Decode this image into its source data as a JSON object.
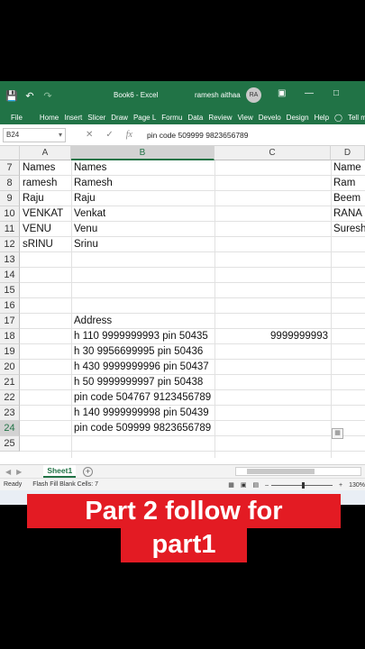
{
  "titlebar": {
    "title": "Book6 - Excel",
    "user": "ramesh aithaa",
    "avatar": "RA",
    "save_icon": "save-icon",
    "undo_icon": "undo-icon",
    "redo_icon": "redo-icon"
  },
  "ribbon": {
    "tabs": [
      "File",
      "Home",
      "Insert",
      "Slicer",
      "Draw",
      "Page L",
      "Formu",
      "Data",
      "Review",
      "View",
      "Develo",
      "Design",
      "Help",
      "Tell me"
    ]
  },
  "formula_bar": {
    "name_box": "B24",
    "fx": "fx",
    "formula": "pin code 509999 9823656789"
  },
  "columns": [
    "A",
    "B",
    "C",
    "D"
  ],
  "rows": [
    {
      "num": "7",
      "A": "Names",
      "B": "Names",
      "C": "",
      "D": "Name"
    },
    {
      "num": "8",
      "A": "ramesh",
      "B": "Ramesh",
      "C": "",
      "D": "Ram"
    },
    {
      "num": "9",
      "A": "Raju",
      "B": "Raju",
      "C": "",
      "D": "Beem"
    },
    {
      "num": "10",
      "A": "VENKAT",
      "B": "Venkat",
      "C": "",
      "D": "RANA"
    },
    {
      "num": "11",
      "A": "VENU",
      "B": "Venu",
      "C": "",
      "D": "Suresh"
    },
    {
      "num": "12",
      "A": "sRINU",
      "B": "Srinu",
      "C": "",
      "D": ""
    },
    {
      "num": "13",
      "A": "",
      "B": "",
      "C": "",
      "D": ""
    },
    {
      "num": "14",
      "A": "",
      "B": "",
      "C": "",
      "D": ""
    },
    {
      "num": "15",
      "A": "",
      "B": "",
      "C": "",
      "D": ""
    },
    {
      "num": "16",
      "A": "",
      "B": "",
      "C": "",
      "D": ""
    },
    {
      "num": "17",
      "A": "",
      "B": "Address",
      "C": "",
      "D": ""
    },
    {
      "num": "18",
      "A": "",
      "B": "h 110 9999999993 pin 50435",
      "C": "9999999993",
      "D": ""
    },
    {
      "num": "19",
      "A": "",
      "B": "h 30 9956699995 pin 50436",
      "C": "",
      "D": ""
    },
    {
      "num": "20",
      "A": "",
      "B": "h 430 9999999996 pin 50437",
      "C": "",
      "D": ""
    },
    {
      "num": "21",
      "A": "",
      "B": "h 50 9999999997 pin 50438",
      "C": "",
      "D": ""
    },
    {
      "num": "22",
      "A": "",
      "B": "pin code 504767 9123456789",
      "C": "",
      "D": ""
    },
    {
      "num": "23",
      "A": "",
      "B": "h 140 9999999998 pin 50439",
      "C": "",
      "D": ""
    },
    {
      "num": "24",
      "A": "",
      "B": "pin code 509999 9823656789",
      "C": "",
      "D": ""
    },
    {
      "num": "25",
      "A": "",
      "B": "",
      "C": "",
      "D": ""
    }
  ],
  "sheet_tab": "Sheet1",
  "status": {
    "ready": "Ready",
    "flash_fill": "Flash Fill Blank Cells: 7",
    "zoom": "130%"
  },
  "banner": {
    "line1": "Part 2 follow for",
    "line2": "part1"
  }
}
